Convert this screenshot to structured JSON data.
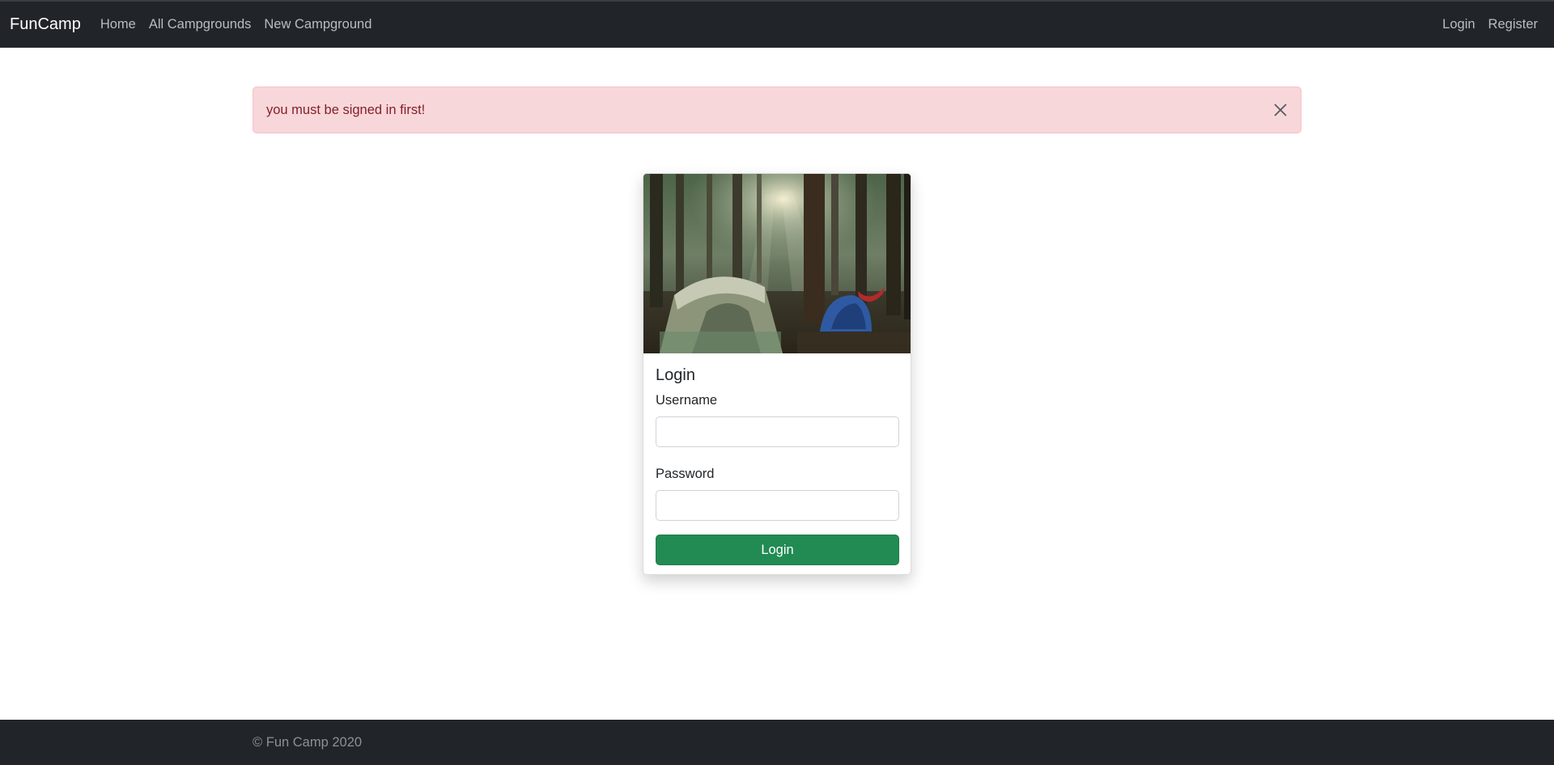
{
  "navbar": {
    "brand": "FunCamp",
    "links": [
      "Home",
      "All Campgrounds",
      "New Campground"
    ],
    "auth_links": [
      "Login",
      "Register"
    ]
  },
  "alert": {
    "message": "you must be signed in first!",
    "close_icon": "close-icon",
    "color": "#842029",
    "background": "#f8d7da"
  },
  "login_card": {
    "image_alt": "forest campground with tents",
    "title": "Login",
    "username_label": "Username",
    "username_value": "",
    "password_label": "Password",
    "password_value": "",
    "submit_label": "Login",
    "button_color": "#218b53"
  },
  "footer": {
    "text": "© Fun Camp 2020"
  }
}
